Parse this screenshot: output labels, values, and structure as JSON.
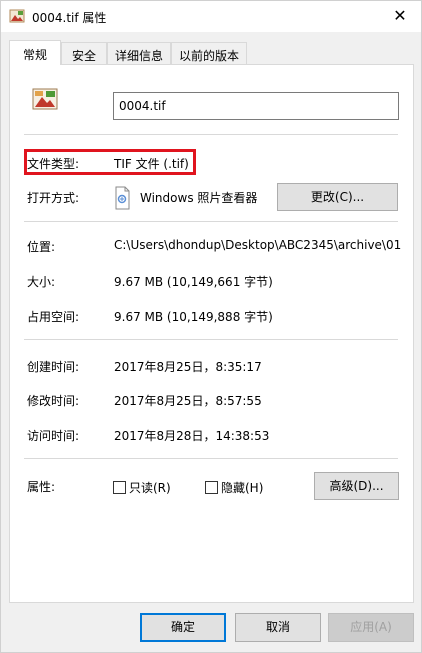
{
  "window": {
    "title": "0004.tif 属性",
    "close_glyph": "✕"
  },
  "tabs": [
    {
      "label": "常规",
      "active": true
    },
    {
      "label": "安全",
      "active": false
    },
    {
      "label": "详细信息",
      "active": false
    },
    {
      "label": "以前的版本",
      "active": false
    }
  ],
  "general": {
    "filename": "0004.tif",
    "file_type_label": "文件类型:",
    "file_type_value": "TIF 文件 (.tif)",
    "opens_with_label": "打开方式:",
    "opens_with_value": "Windows 照片查看器",
    "change_button": "更改(C)...",
    "location_label": "位置:",
    "location_value": "C:\\Users\\dhondup\\Desktop\\ABC2345\\archive\\01",
    "size_label": "大小:",
    "size_value": "9.67 MB (10,149,661 字节)",
    "disk_size_label": "占用空间:",
    "disk_size_value": "9.67 MB (10,149,888 字节)",
    "created_label": "创建时间:",
    "created_value": "2017年8月25日，8:35:17",
    "modified_label": "修改时间:",
    "modified_value": "2017年8月25日，8:57:55",
    "accessed_label": "访问时间:",
    "accessed_value": "2017年8月28日，14:38:53",
    "attributes_label": "属性:",
    "readonly_label": "只读(R)",
    "readonly_checked": false,
    "hidden_label": "隐藏(H)",
    "hidden_checked": false,
    "advanced_button": "高级(D)..."
  },
  "footer": {
    "ok": "确定",
    "cancel": "取消",
    "apply": "应用(A)"
  },
  "colors": {
    "highlight": "#e0141e",
    "primary_border": "#0078d7"
  }
}
